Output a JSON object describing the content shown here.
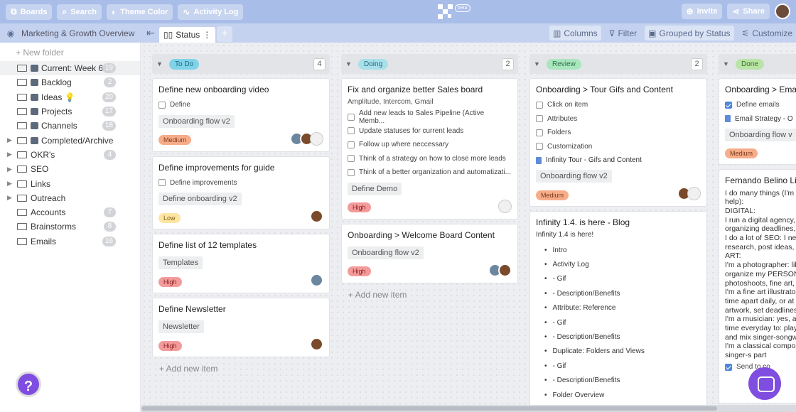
{
  "topbar": {
    "boards": "Boards",
    "search": "Search",
    "theme": "Theme Color",
    "activity": "Activity Log",
    "beta": "beta",
    "invite": "Invite",
    "share": "Share"
  },
  "subbar": {
    "board_title": "Marketing & Growth Overview",
    "view_tab": "Status",
    "columns": "Columns",
    "filter": "Filter",
    "grouped": "Grouped by Status",
    "customize": "Customize"
  },
  "sidebar": {
    "new_folder": "+ New folder",
    "folders": [
      {
        "name": "Current: Week 6",
        "count": "19"
      },
      {
        "name": "Backlog",
        "count": "2"
      },
      {
        "name": "Ideas 💡",
        "count": "20"
      },
      {
        "name": "Projects",
        "count": "17"
      },
      {
        "name": "Channels",
        "count": "18"
      },
      {
        "name": "Completed/Archive",
        "count": ""
      },
      {
        "name": "OKR's",
        "count": "4"
      },
      {
        "name": "SEO",
        "count": ""
      },
      {
        "name": "Links",
        "count": ""
      },
      {
        "name": "Outreach",
        "count": ""
      },
      {
        "name": "Accounts",
        "count": "7"
      },
      {
        "name": "Brainstorms",
        "count": "8"
      },
      {
        "name": "Emails",
        "count": "16"
      }
    ],
    "help": "?"
  },
  "columns": {
    "todo": {
      "label": "To Do",
      "count": "4",
      "color": "#7fd3e8",
      "cards": [
        {
          "title": "Define new onboarding video",
          "check1": "Define",
          "tag": "Onboarding flow v2",
          "badge": "Medium"
        },
        {
          "title": "Define improvements for guide",
          "check1": "Define improvements",
          "tag": "Define onboarding v2",
          "badge": "Low"
        },
        {
          "title": "Define list of 12 templates",
          "tag": "Templates",
          "badge": "High"
        },
        {
          "title": "Define Newsletter",
          "tag": "Newsletter",
          "badge": "High"
        }
      ],
      "add": "+ Add new item"
    },
    "doing": {
      "label": "Doing",
      "count": "2",
      "color": "#a8e0ea",
      "card1": {
        "title": "Fix and organize better Sales board",
        "text": "Amplitude, Intercom, Gmail",
        "checks": [
          "Add new leads to Sales Pipeline (Active Memb...",
          "Update statuses for current leads",
          "Follow up where neccessary",
          "Think of a strategy on how to close more leads",
          "Think of a better organization and automatizati..."
        ],
        "tag": "Define Demo",
        "badge": "High"
      },
      "card2": {
        "title": "Onboarding > Welcome Board Content",
        "tag": "Onboarding flow v2",
        "badge": "High"
      },
      "add": "+ Add new item"
    },
    "review": {
      "label": "Review",
      "count": "2",
      "color": "#a9e6bd",
      "card1": {
        "title": "Onboarding > Tour Gifs and Content",
        "checks": [
          "Click on item",
          "Attributes",
          "Folders",
          "Customization"
        ],
        "doc": "Infinity Tour - Gifs and Content",
        "tag": "Onboarding flow v2",
        "badge": "Medium"
      },
      "card2": {
        "title": "Infinity 1.4. is here - Blog",
        "intro": "Infinity 1.4 is here!",
        "bullets": [
          "Intro",
          "Activity Log",
          "- Gif",
          "- Description/Benefits",
          "Attribute: Reference",
          "- Gif",
          "- Description/Benefits",
          "Duplicate: Folders and Views",
          "- Gif",
          "- Description/Benefits",
          "Folder Overview"
        ]
      }
    },
    "done": {
      "label": "Done",
      "color": "#b9e4a6",
      "card1": {
        "title": "Onboarding > Email",
        "check": "Define emails",
        "doc": "Email Strategy - O",
        "tag": "Onboarding flow v",
        "badge": "Medium"
      },
      "card2": {
        "title": "Fernando Belino Liv",
        "lines": [
          "I do many things (I'm n",
          "help):",
          "DIGITAL:",
          "I run a digital agency, a",
          "organizing deadlines, c",
          "I do a lot of SEO: I nee",
          "research, post ideas, r",
          "ART:",
          "I'm a photographer: lik",
          "organize my PERSONA",
          "photoshoots, fine art, a",
          "I'm a fine art illustrato",
          "time apart daily, or at l",
          "artwork, set deadlines",
          "I'm a musician: yes, a s",
          "time everyday to: play",
          "and mix singer-songwr",
          "I'm a classical compos",
          "singer-s          part",
          "             "
        ],
        "send": "Send       to co"
      }
    }
  }
}
